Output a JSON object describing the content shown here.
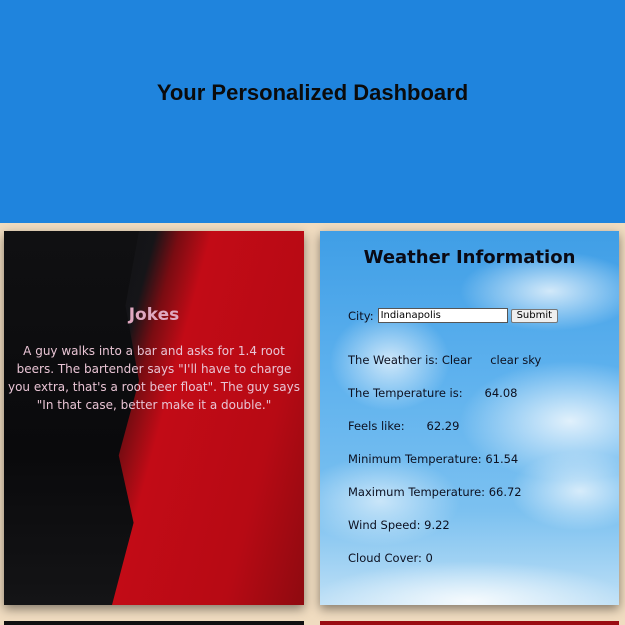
{
  "header": {
    "title": "Your Personalized Dashboard"
  },
  "colors": {
    "header_bg": "#1f84dd",
    "page_bg": "#f0dcc0"
  },
  "jokes": {
    "title": "Jokes",
    "text": "A guy walks into a bar and asks for 1.4 root beers. The bartender says \"I'll have to charge you extra, that's a root beer float\". The guy says \"In that case, better make it a double.\""
  },
  "weather": {
    "title": "Weather Information",
    "city_label": "City:",
    "city_value": "Indianapolis",
    "submit_label": "Submit",
    "lines": {
      "weather": "The Weather is: Clear     clear sky",
      "temperature": "The Temperature is:      64.08",
      "feels_like": "Feels like:      62.29",
      "min_temp": "Minimum Temperature: 61.54",
      "max_temp": "Maximum Temperature: 66.72",
      "wind": "Wind Speed: 9.22",
      "clouds": "Cloud Cover: 0"
    }
  }
}
